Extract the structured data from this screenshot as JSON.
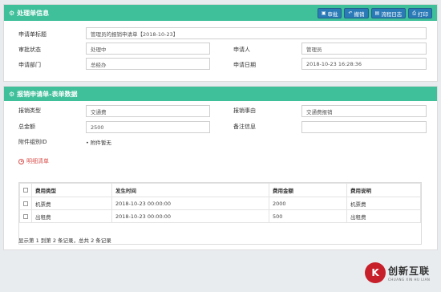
{
  "panel1": {
    "title": "处理单信息",
    "buttons": [
      {
        "label": "审批",
        "icon": "audit-icon"
      },
      {
        "label": "撤销",
        "icon": "undo-icon"
      },
      {
        "label": "流程日志",
        "icon": "log-icon"
      },
      {
        "label": "打印",
        "icon": "print-icon"
      }
    ],
    "fields": {
      "title_label": "申请单标题",
      "title_value": "管理员的报销申请单【2018-10-23】",
      "status_label": "审批状态",
      "status_value": "处理中",
      "applicant_label": "申请人",
      "applicant_value": "管理员",
      "dept_label": "申请部门",
      "dept_value": "总经办",
      "date_label": "申请日期",
      "date_value": "2018-10-23 16:28:36"
    }
  },
  "panel2": {
    "title": "报销申请单-表单数据",
    "fields": {
      "type_label": "报销类型",
      "type_value": "交通费",
      "reason_label": "报销事由",
      "reason_value": "交通费报销",
      "amount_label": "总金额",
      "amount_value": "2500",
      "remark_label": "备注信息",
      "remark_value": "",
      "attach_label": "附件组别ID",
      "attach_value": "• 附件暂无"
    },
    "detail_link": "明细清单",
    "table": {
      "headers": [
        "费用类型",
        "发生时间",
        "费用金额",
        "费用说明"
      ],
      "rows": [
        [
          "机票费",
          "2018-10-23 00:00:00",
          "2000",
          "机票费"
        ],
        [
          "出租费",
          "2018-10-23 00:00:00",
          "500",
          "出租费"
        ]
      ]
    },
    "pager": "显示第 1 到第 2 条记录，总共 2 条记录"
  },
  "watermark": {
    "logo": "K",
    "name": "创新互联",
    "sub": "CHUANG XIN HU LIAN"
  }
}
